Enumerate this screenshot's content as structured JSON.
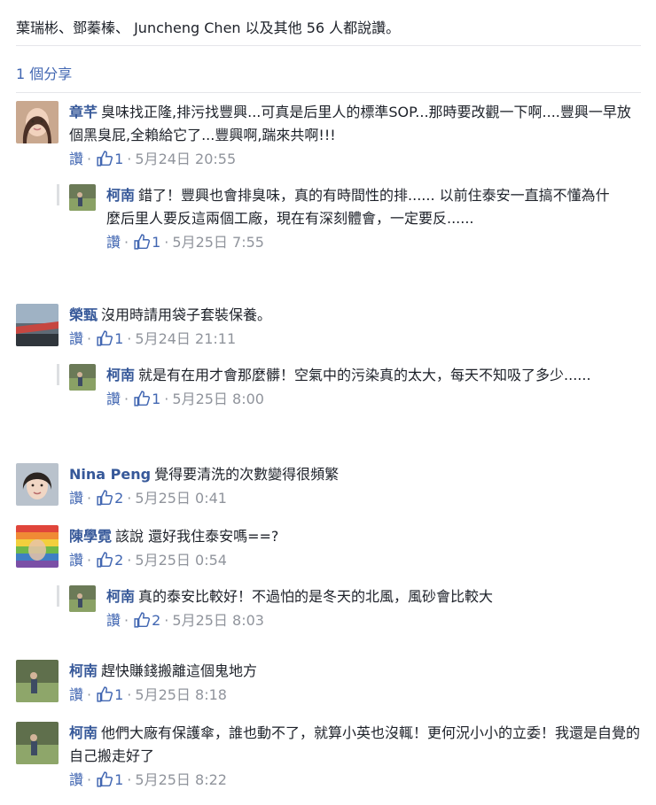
{
  "likes_summary": "葉瑞彬、鄧蓁榛、 Juncheng Chen 以及其他 56 人都說讚。",
  "shares": "1 個分享",
  "like_label": "讚",
  "comments": [
    {
      "author": "章芊",
      "text": "臭味找正隆,排污找豐興...可真是后里人的標準SOP...那時要改觀一下啊....豐興一早放個黑臭屁,全賴給它了...豐興啊,踹來共啊!!!",
      "likes": "1",
      "time": "5月24日 20:55"
    },
    {
      "author": "柯南",
      "text": "錯了！豐興也會排臭味，真的有時間性的排...... 以前住泰安一直搞不懂為什麼后里人要反這兩個工廠，現在有深刻體會，一定要反......",
      "likes": "1",
      "time": "5月25日 7:55"
    },
    {
      "author": "榮甄",
      "text": "沒用時請用袋子套裝保養。",
      "likes": "1",
      "time": "5月24日 21:11"
    },
    {
      "author": "柯南",
      "text": "就是有在用才會那麼髒！空氣中的污染真的太大，每天不知吸了多少......",
      "likes": "1",
      "time": "5月25日 8:00"
    },
    {
      "author": "Nina Peng",
      "text": "覺得要清洗的次數變得很頻繁",
      "likes": "2",
      "time": "5月25日 0:41"
    },
    {
      "author": "陳學霓",
      "text": "該說 還好我住泰安嗎==?",
      "likes": "2",
      "time": "5月25日 0:54"
    },
    {
      "author": "柯南",
      "text": "真的泰安比較好！不過怕的是冬天的北風，風砂會比較大",
      "likes": "2",
      "time": "5月25日 8:03"
    },
    {
      "author": "柯南",
      "text": "趕快賺錢搬離這個鬼地方",
      "likes": "1",
      "time": "5月25日 8:18"
    },
    {
      "author": "柯南",
      "text": "他們大廠有保護傘，誰也動不了，就算小英也沒輒！更何況小小的立委！我還是自覺的自己搬走好了",
      "likes": "1",
      "time": "5月25日 8:22"
    }
  ]
}
